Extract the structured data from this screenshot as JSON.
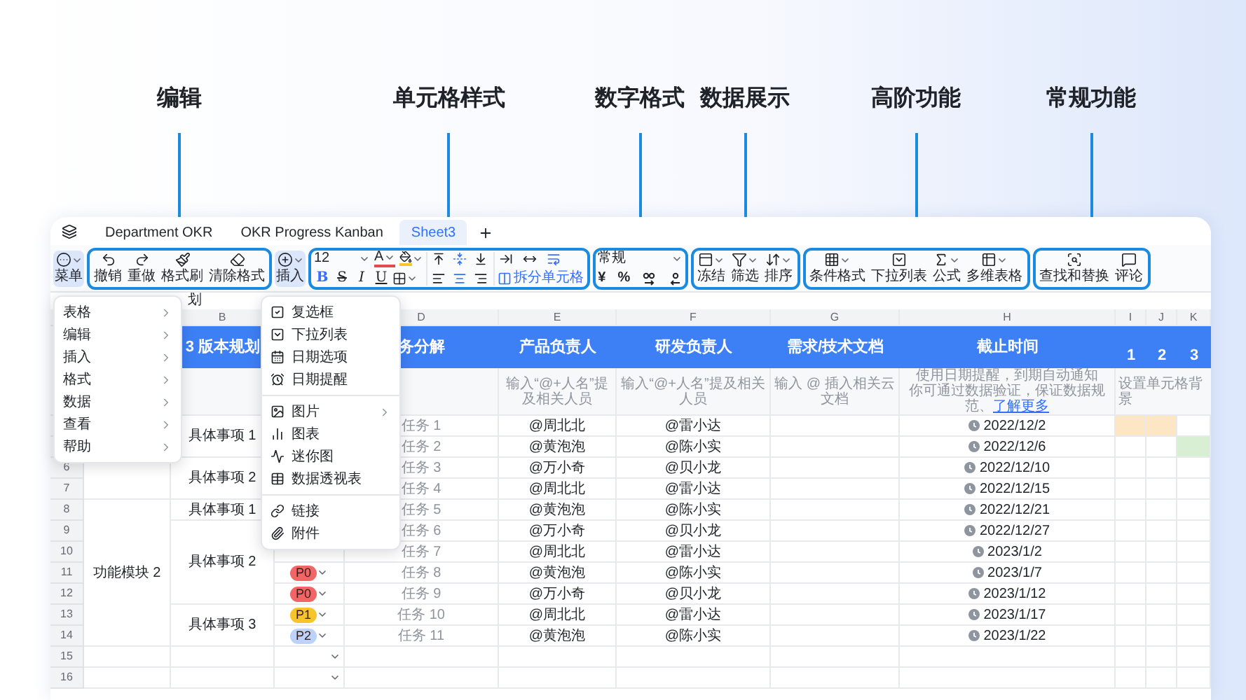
{
  "tabs": [
    {
      "label": "Department OKR",
      "selected": false
    },
    {
      "label": "OKR Progress Kanban",
      "selected": false
    },
    {
      "label": "Sheet3",
      "selected": true
    }
  ],
  "toolbar": {
    "menu_button": {
      "label": "菜单",
      "open": true
    },
    "edit_group": {
      "annotation": "编辑",
      "buttons": [
        "撤销",
        "重做",
        "格式刷",
        "清除格式"
      ]
    },
    "insert_button": {
      "label": "插入",
      "open": true
    },
    "style_group": {
      "annotation": "单元格样式",
      "font_size": "12",
      "text_color_label": "A",
      "format_buttons": [
        {
          "label": "B",
          "selected": true
        },
        {
          "label": "S",
          "selected": false
        },
        {
          "label": "I",
          "selected": false
        },
        {
          "label": "U",
          "selected": false
        }
      ],
      "vertical_align": [
        {
          "selected": false
        },
        {
          "selected": true
        },
        {
          "selected": false
        }
      ],
      "horizontal_align": [
        {
          "selected": false
        },
        {
          "selected": true
        },
        {
          "selected": false
        }
      ],
      "wrap_options": [
        {
          "selected": false
        },
        {
          "selected": false
        },
        {
          "selected": true
        }
      ],
      "merge_label": "拆分单元格"
    },
    "number_group": {
      "annotation": "数字格式",
      "format": "常规",
      "symbols": [
        "¥",
        "%"
      ]
    },
    "data_group": {
      "annotation": "数据展示",
      "buttons": [
        "冻结",
        "筛选",
        "排序"
      ]
    },
    "advanced_group": {
      "annotation": "高阶功能",
      "buttons": [
        "条件格式",
        "下拉列表",
        "公式",
        "多维表格"
      ]
    },
    "common_group": {
      "annotation": "常规功能",
      "buttons": [
        "查找和替换",
        "评论"
      ]
    }
  },
  "left_menu": {
    "items": [
      {
        "label": "表格",
        "submenu": true
      },
      {
        "label": "编辑",
        "submenu": true
      },
      {
        "label": "插入",
        "submenu": true
      },
      {
        "label": "格式",
        "submenu": true
      },
      {
        "label": "数据",
        "submenu": true
      },
      {
        "label": "查看",
        "submenu": true
      },
      {
        "label": "帮助",
        "submenu": true
      }
    ]
  },
  "insert_menu": {
    "sections": [
      {
        "items": [
          {
            "label": "复选框",
            "submenu": false
          },
          {
            "label": "下拉列表",
            "submenu": false
          },
          {
            "label": "日期选项",
            "submenu": false
          },
          {
            "label": "日期提醒",
            "submenu": false
          }
        ]
      },
      {
        "items": [
          {
            "label": "图片",
            "submenu": true
          },
          {
            "label": "图表",
            "submenu": false
          },
          {
            "label": "迷你图",
            "submenu": false
          },
          {
            "label": "数据透视表",
            "submenu": false
          }
        ]
      },
      {
        "items": [
          {
            "label": "链接",
            "submenu": false
          },
          {
            "label": "附件",
            "submenu": false
          }
        ]
      }
    ]
  },
  "sheet": {
    "title_fragment": "划",
    "columns": [
      {},
      {
        "letter": "B",
        "header": "3 版本规划"
      },
      {},
      {
        "letter": "D",
        "header": "务分解"
      },
      {
        "letter": "E",
        "header": "产品负责人",
        "hint": "输入“@+人名”提及相关人员"
      },
      {
        "letter": "F",
        "header": "研发负责人",
        "hint": "输入“@+人名”提及相关人员"
      },
      {
        "letter": "G",
        "header": "需求/技术文档",
        "hint": "输入 @ 插入相关云文档"
      },
      {
        "letter": "H",
        "header": "截止时间",
        "hint": "使用日期提醒，到期自动通知",
        "hint_2": "你可通过数据验证，保证数据规范、",
        "hint_link": "了解更多"
      },
      {
        "letter": "I",
        "header": "1"
      },
      {
        "letter": "J",
        "header": "2"
      },
      {
        "letter": "K",
        "header": "3"
      }
    ],
    "gantt_hint": "设置单元格背景",
    "row_numbers": [
      "6",
      "7",
      "8",
      "9",
      "10",
      "11",
      "12",
      "13",
      "14",
      "15",
      "16"
    ],
    "modules": [
      {
        "items": [
          {
            "name": "具体事项 1",
            "tasks": [
              {
                "task": "任务 1",
                "product": "@周北北",
                "dev": "@雷小达",
                "date": "2022/12/2",
                "fills": [
                  {
                    "filled": true,
                    "color": "#fce6c4"
                  },
                  {
                    "filled": true,
                    "color": "#fce6c4"
                  },
                  {
                    "filled": false
                  }
                ]
              },
              {
                "task": "任务 2",
                "product": "@黄泡泡",
                "dev": "@陈小实",
                "date": "2022/12/6",
                "fills": [
                  {
                    "filled": false
                  },
                  {
                    "filled": false
                  },
                  {
                    "filled": true,
                    "color": "#d9efd3"
                  }
                ]
              }
            ]
          },
          {
            "name": "具体事项 2",
            "tasks": [
              {
                "task": "任务 3",
                "product": "@万小奇",
                "dev": "@贝小龙",
                "date": "2022/12/10"
              },
              {
                "task": "任务 4",
                "product": "@周北北",
                "dev": "@雷小达",
                "date": "2022/12/15"
              }
            ]
          }
        ]
      },
      {
        "name": "功能模块 2",
        "items": [
          {
            "name": "具体事项 1",
            "tasks": [
              {
                "task": "任务 5",
                "product": "@黄泡泡",
                "dev": "@陈小实",
                "date": "2022/12/21"
              }
            ]
          },
          {
            "name": "具体事项 2",
            "tasks": [
              {
                "task": "任务 6",
                "product": "@万小奇",
                "dev": "@贝小龙",
                "date": "2022/12/27"
              },
              {
                "task": "任务 7",
                "product": "@周北北",
                "dev": "@雷小达",
                "date": "2023/1/2"
              },
              {
                "task": "任务 8",
                "product": "@黄泡泡",
                "dev": "@陈小实",
                "date": "2023/1/7",
                "priority": {
                  "label": "P0",
                  "color": "#f26565"
                }
              },
              {
                "task": "任务 9",
                "product": "@万小奇",
                "dev": "@贝小龙",
                "date": "2023/1/12",
                "priority": {
                  "label": "P0",
                  "color": "#f26565"
                }
              }
            ]
          },
          {
            "name": "具体事项 3",
            "tasks": [
              {
                "task": "任务 10",
                "product": "@周北北",
                "dev": "@雷小达",
                "date": "2023/1/17",
                "priority": {
                  "label": "P1",
                  "color": "#f7c52b"
                }
              },
              {
                "task": "任务 11",
                "product": "@黄泡泡",
                "dev": "@陈小实",
                "date": "2023/1/22",
                "priority": {
                  "label": "P2",
                  "color": "#bcd2fb"
                }
              }
            ]
          }
        ]
      }
    ],
    "empty_rows": [
      {
        "dropdown": true
      },
      {
        "dropdown": true
      }
    ]
  }
}
